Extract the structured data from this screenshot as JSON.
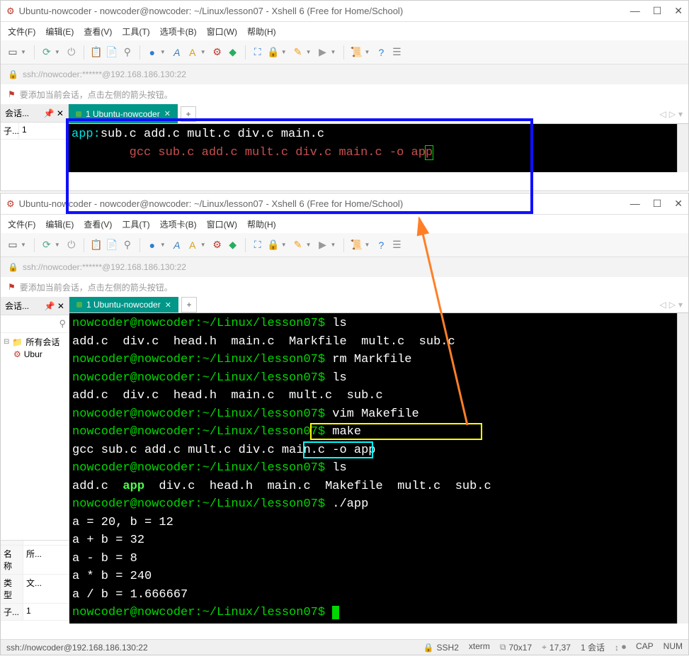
{
  "window1": {
    "title": "Ubuntu-nowcoder - nowcoder@nowcoder: ~/Linux/lesson07 - Xshell 6 (Free for Home/School)"
  },
  "window2": {
    "title": "Ubuntu-nowcoder - nowcoder@nowcoder: ~/Linux/lesson07 - Xshell 6 (Free for Home/School)"
  },
  "menubar": {
    "file": "文件(F)",
    "edit": "编辑(E)",
    "view": "查看(V)",
    "tools": "工具(T)",
    "tabs": "选项卡(B)",
    "window": "窗口(W)",
    "help": "帮助(H)"
  },
  "address": "ssh://nowcoder:******@192.168.186.130:22",
  "hint": "要添加当前会话，点击左侧的箭头按钮。",
  "sessions_label": "会话...",
  "sidebar_row_label": "子...",
  "sidebar_row_value": "1",
  "tab": {
    "label": "1 Ubuntu-nowcoder"
  },
  "terminal1": {
    "line1a": "app:",
    "line1b": "sub.c add.c mult.c div.c main.c",
    "line2_indent": "        ",
    "line2": "gcc sub.c add.c mult.c div.c main.c -o ap",
    "line2_cursor": "p"
  },
  "tree": {
    "folder": "所有会话",
    "file": "Ubur"
  },
  "props": {
    "name_label": "名称",
    "name_value": "所...",
    "type_label": "类型",
    "type_value": "文...",
    "sub_label": "子...",
    "sub_value": "1"
  },
  "terminal2": {
    "prompt": "nowcoder@nowcoder:~/Linux/lesson07$ ",
    "cmd_ls": "ls",
    "cmd_rm": "rm Markfile",
    "cmd_vim": "vim Makefile",
    "cmd_make": "make",
    "cmd_run": "./app",
    "listing1": "add.c  div.c  head.h  main.c  Markfile  mult.c  sub.c",
    "listing2": "add.c  div.c  head.h  main.c  mult.c  sub.c",
    "gcc_line": "gcc sub.c add.c mult.c div.c main.c -o app",
    "listing3a": "add.c  ",
    "listing3_app": "app",
    "listing3b": "  div.c  head.h  main.c  Makefile  mult.c  sub.c",
    "out1": "a = 20, b = 12",
    "out2": "a + b = 32",
    "out3": "a - b = 8",
    "out4": "a * b = 240",
    "out5": "a / b = 1.666667"
  },
  "status": {
    "ssh_url": "ssh://nowcoder@192.168.186.130:22",
    "proto": "SSH2",
    "term": "xterm",
    "size": "70x17",
    "pos": "17,37",
    "sessions": "1 会话",
    "cap": "CAP",
    "num": "NUM"
  }
}
